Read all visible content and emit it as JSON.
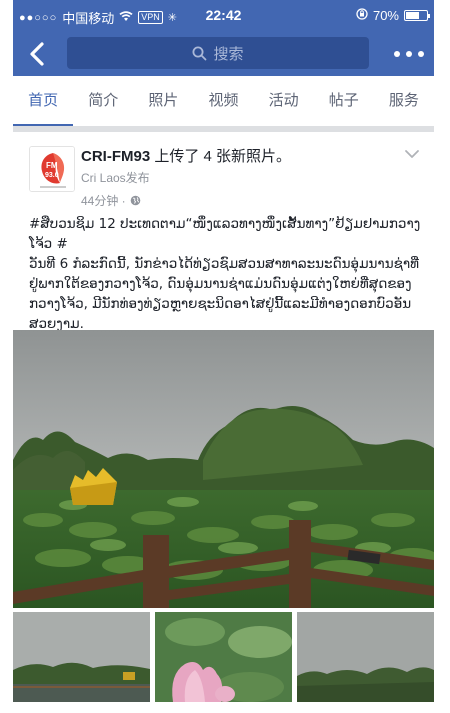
{
  "status_bar": {
    "carrier": "中国移动",
    "vpn": "VPN",
    "time": "22:42",
    "battery": "70%",
    "battery_level": 0.7
  },
  "nav": {
    "search_placeholder": "搜索"
  },
  "tabs": [
    {
      "label": "首页",
      "active": true
    },
    {
      "label": "简介",
      "active": false
    },
    {
      "label": "照片",
      "active": false
    },
    {
      "label": "视频",
      "active": false
    },
    {
      "label": "活动",
      "active": false
    },
    {
      "label": "帖子",
      "active": false
    },
    {
      "label": "服务",
      "active": false
    }
  ],
  "post": {
    "page_name": "CRI-FM93",
    "action": " 上传了 4 张新照片。",
    "publisher": "Cri Laos发布",
    "time": "44分钟 ·",
    "avatar_text": "FM\n93.0",
    "paragraph1": "#ສືບວນຊິມ 12 ປະເທດຕາມ“ໜຶ່ງແລວທາງໜຶ່ງເສັ້ນທາງ”ຢ້ຽມຢາມກວາງໂຈ້ວ #",
    "paragraph2": "ວັນທີ 6 ກໍລະກົດນີ້, ນັກຂ່າວໄດ້ທ່ຽວຊົມສວນສາທາລະນະດົນອຸ່ມນານຊ່າທີ່ຢູ່ພາກໃຕ້ຂອງກວາງໂຈ້ວ, ດົນອຸ່ມນານຊ່າແມ່ນດົນອຸ່ມແຕ່ງໃຫຍ່ທີ່ສຸດຂອງກວາງໂຈ້ວ, ມີນັກທ່ອງທ່ຽວຫຼາຍຊະນິດອາໄສຢູ່ນີ້ແລະມີທຳອງດອກບົວອັນສວຍງາມ."
  },
  "colors": {
    "brand": "#4267b2",
    "search_bg": "#2f4f93",
    "divider": "#dddfe2"
  }
}
